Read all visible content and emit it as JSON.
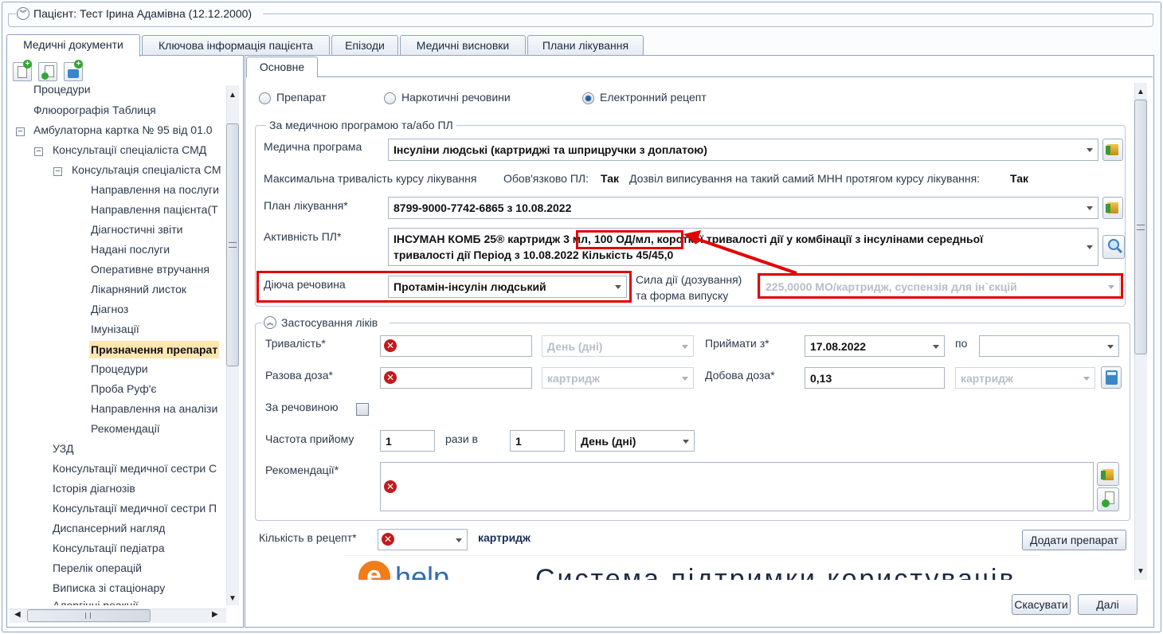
{
  "header": {
    "title": "Пацієнт: Тест Ірина Адамівна (12.12.2000)"
  },
  "tabs": [
    {
      "label": "Медичні документи"
    },
    {
      "label": "Ключова інформація пацієнта"
    },
    {
      "label": "Епізоди"
    },
    {
      "label": "Медичні висновки"
    },
    {
      "label": "Плани лікування"
    }
  ],
  "inner_tab": "Основне",
  "tree": {
    "items": [
      "Процедури",
      "Флюорографія Таблиця",
      "Амбулаторна картка № 95 від 01.0",
      "Консультації спеціаліста СМД",
      "Консультація спеціаліста СМ",
      "Направлення на послуги",
      "Направлення пацієнта(Т",
      "Діагностичні звіти",
      "Надані послуги",
      "Оперативне втручання",
      "Лікарняний листок",
      "Діагноз",
      "Імунізації",
      "Призначення препарат",
      "Процедури",
      "Проба Руф'є",
      "Направлення на аналізи",
      "Рекомендації",
      "УЗД",
      "Консультації медичної сестри С",
      "Історія діагнозів",
      "Консультації медичної сестри П",
      "Диспансерний нагляд",
      "Консультації педіатра",
      "Перелік операцій",
      "Виписка зі стаціонару",
      "Алергічні реакції"
    ]
  },
  "radios": {
    "preparat": "Препарат",
    "narcotic": "Наркотичні речовини",
    "erecipe": "Електронний рецепт",
    "selected": "Електронний рецепт"
  },
  "program_group": {
    "legend": "За медичною програмою та/або ПЛ",
    "med_program_label": "Медична програма",
    "med_program_value": "Інсуліни людські (картриджі та шприцручки з доплатою)",
    "max_duration_label": "Максимальна тривалість курсу лікування",
    "mandatory_label": "Обов'язково ПЛ:",
    "mandatory_value": "Так",
    "permit_label": "Дозвіл виписування на такий самий МНН протягом курсу лікування:",
    "permit_value": "Так",
    "plan_label": "План лікування*",
    "plan_value": "8799-9000-7742-6865 з 10.08.2022",
    "activity_label": "Активність ПЛ*",
    "activity_line1_a": "ІНСУМАН КОМБ 25® картридж ",
    "activity_line1_b": "3 мл, 100 ОД/мл,",
    "activity_line1_c": " короткої тривалості дії у комбінації з інсулінами середньої",
    "activity_line2": "тривалості дії Період з 10.08.2022 Кількість 45/45,0",
    "substance_label": "Діюча речовина",
    "substance_value": "Протамін-інсулін людський",
    "strength_label_1": "Сила дії (дозування)",
    "strength_label_2": "та форма випуску",
    "strength_value": "225,0000 МО/картридж, суспензія для ін`єкцій"
  },
  "usage_group": {
    "legend": "Застосування ліків",
    "duration_label": "Тривалість*",
    "duration_unit": "День (дні)",
    "take_from_label": "Приймати з*",
    "take_from_value": "17.08.2022",
    "to_label": "по",
    "to_value": "",
    "single_dose_label": "Разова доза*",
    "single_dose_unit": "картридж",
    "daily_dose_label": "Добова доза*",
    "daily_dose_value": "0,13",
    "daily_dose_unit": "картридж",
    "by_substance_label": "За речовиною",
    "freq_label": "Частота прийому",
    "freq_value": "1",
    "times_in_label": "рази в",
    "times_in_value": "1",
    "freq_unit": "День (дні)",
    "recommend_label": "Рекомендації*"
  },
  "qty_label": "Кількість в рецепт*",
  "qty_unit": "картридж",
  "add_button": "Додати препарат",
  "banner": {
    "logo_letter": "e",
    "logo_rest": "help",
    "text": "Система підтримки користувачів"
  },
  "buttons": {
    "cancel": "Скасувати",
    "next": "Далі"
  }
}
